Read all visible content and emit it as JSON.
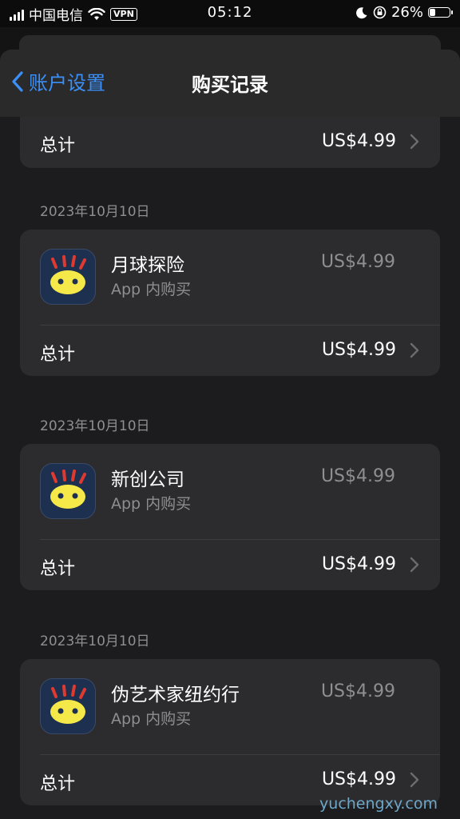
{
  "status_bar": {
    "carrier": "中国电信",
    "vpn": "VPN",
    "time": "05:12",
    "battery": "26%",
    "battery_level": 0.26
  },
  "nav": {
    "back_label": "账户设置",
    "title": "购买记录"
  },
  "top_card": {
    "total_label": "总计",
    "total_price": "US$4.99"
  },
  "groups": [
    {
      "date": "2023年10月10日",
      "item_name": "月球探险",
      "item_type": "App 内购买",
      "item_price": "US$4.99",
      "total_label": "总计",
      "total_price": "US$4.99"
    },
    {
      "date": "2023年10月10日",
      "item_name": "新创公司",
      "item_type": "App 内购买",
      "item_price": "US$4.99",
      "total_label": "总计",
      "total_price": "US$4.99"
    },
    {
      "date": "2023年10月10日",
      "item_name": "伪艺术家纽约行",
      "item_type": "App 内购买",
      "item_price": "US$4.99",
      "total_label": "总计",
      "total_price": "US$4.99"
    }
  ],
  "watermark": "yuchengxy.com",
  "colors": {
    "accent": "#3b8ff7",
    "secondary_text": "#8e8e93",
    "card": "#2c2c2e",
    "icon_bg": "#1e3050",
    "icon_face": "#f5e94a",
    "icon_spikes": "#e0392f"
  },
  "icons": [
    "chevron-left-icon",
    "chevron-right-icon",
    "wifi-icon",
    "moon-icon",
    "orientation-lock-icon",
    "battery-icon",
    "app-icon"
  ]
}
